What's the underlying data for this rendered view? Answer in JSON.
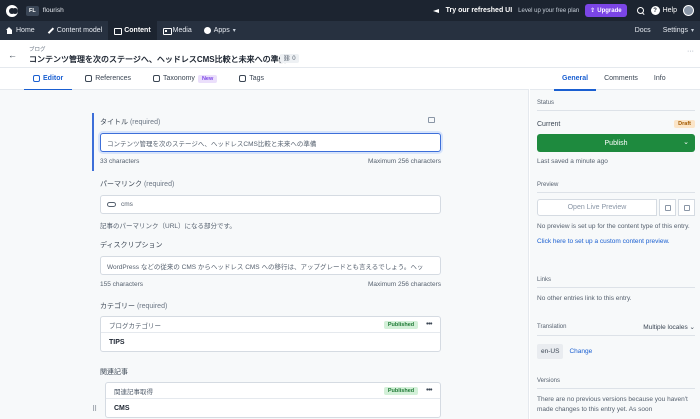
{
  "topbar": {
    "space_badge": "FL",
    "space_name": "flourish",
    "try_text": "Try our refreshed UI",
    "level_text": "Level up your free plan",
    "upgrade_label": "Upgrade",
    "help_label": "Help"
  },
  "nav": {
    "items": [
      {
        "label": "Home",
        "icon": "home-icon"
      },
      {
        "label": "Content model",
        "icon": "wrench-icon"
      },
      {
        "label": "Content",
        "icon": "content-icon",
        "active": true
      },
      {
        "label": "Media",
        "icon": "media-icon"
      },
      {
        "label": "Apps",
        "icon": "apps-icon"
      }
    ],
    "docs_label": "Docs",
    "settings_label": "Settings"
  },
  "entry": {
    "breadcrumb": "ブログ",
    "title": "コンテンツ管理を次のステージへ、ヘッドレスCMS比較と未来への準備",
    "link_count": "0"
  },
  "tabs": {
    "editor": "Editor",
    "references": "References",
    "taxonomy": "Taxonomy",
    "new_badge": "New",
    "tags": "Tags"
  },
  "fields": {
    "title": {
      "label": "タイトル",
      "required": "(required)",
      "value": "コンテンツ管理を次のステージへ、ヘッドレスCMS比較と未来への準備",
      "count": "33 characters",
      "max": "Maximum 256 characters"
    },
    "slug": {
      "label": "パーマリンク",
      "required": "(required)",
      "value": "cms",
      "help": "記事のパーマリンク（URL）になる部分です。"
    },
    "description": {
      "label": "ディスクリプション",
      "value": "WordPress などの従来の CMS からヘッドレス CMS への移行は、アップグレードとも言えるでしょう。ヘッ",
      "count": "155 characters",
      "max": "Maximum 256 characters"
    },
    "category": {
      "label": "カテゴリー",
      "required": "(required)",
      "ref_type": "ブログカテゴリー",
      "status": "Published",
      "value": "TIPS"
    },
    "related": {
      "label": "関連記事",
      "ref_type": "関連記事取得",
      "status": "Published",
      "value": "CMS"
    }
  },
  "sidebar": {
    "tabs": [
      "General",
      "Comments",
      "Info"
    ],
    "status_title": "Status",
    "current_label": "Current",
    "current_status": "Draft",
    "publish_label": "Publish",
    "saved_text": "Last saved a minute ago",
    "preview_title": "Preview",
    "preview_button": "Open Live Preview",
    "preview_note": "No preview is set up for the content type of this entry.",
    "preview_link": "Click here to set up a custom content preview.",
    "links_title": "Links",
    "links_note": "No other entries link to this entry.",
    "translation_title": "Translation",
    "translation_mode": "Multiple locales",
    "locale": "en-US",
    "change_label": "Change",
    "versions_title": "Versions",
    "versions_note": "There are no previous versions because you haven't made changes to this entry yet. As soon"
  },
  "colors": {
    "topbar": "#1c2430",
    "accent": "#1a5fd1",
    "publish": "#1e8a3e",
    "upgrade": "#7b45e6"
  }
}
